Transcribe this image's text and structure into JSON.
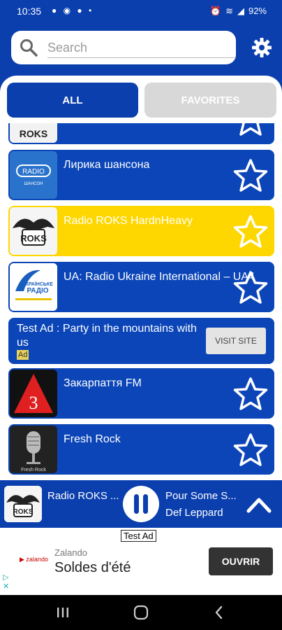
{
  "status": {
    "time": "10:35",
    "battery": "92%"
  },
  "search": {
    "placeholder": "Search"
  },
  "tabs": {
    "all": "ALL",
    "favorites": "FAVORITES"
  },
  "stations": [
    {
      "name": "Лирика шансона",
      "logo": "radio-chanson-logo",
      "highlight": false
    },
    {
      "name": "Radio ROKS HardnHeavy",
      "logo": "radio-roks-logo",
      "highlight": true
    },
    {
      "name": "UA: Radio Ukraine International – UA4",
      "logo": "ukrainian-radio-logo",
      "highlight": false
    },
    {
      "name": "Закарпаття FM",
      "logo": "zakarpattia-fm-logo",
      "highlight": false
    },
    {
      "name": "Fresh Rock",
      "logo": "fresh-rock-logo",
      "highlight": false
    }
  ],
  "ad_row": {
    "title": "Test Ad : Party in the mountains with us",
    "badge": "Ad",
    "button": "VISIT SITE"
  },
  "player": {
    "station": "Radio ROKS ...",
    "song": "Pour Some S...",
    "artist": "Def Leppard"
  },
  "banner": {
    "label": "Test Ad",
    "brand": "Zalando",
    "headline": "Soldes d'été",
    "button": "OUVRIR"
  },
  "colors": {
    "primary": "#0b3fae",
    "highlight": "#ffd700",
    "inactive_tab": "#d8d8d8"
  }
}
